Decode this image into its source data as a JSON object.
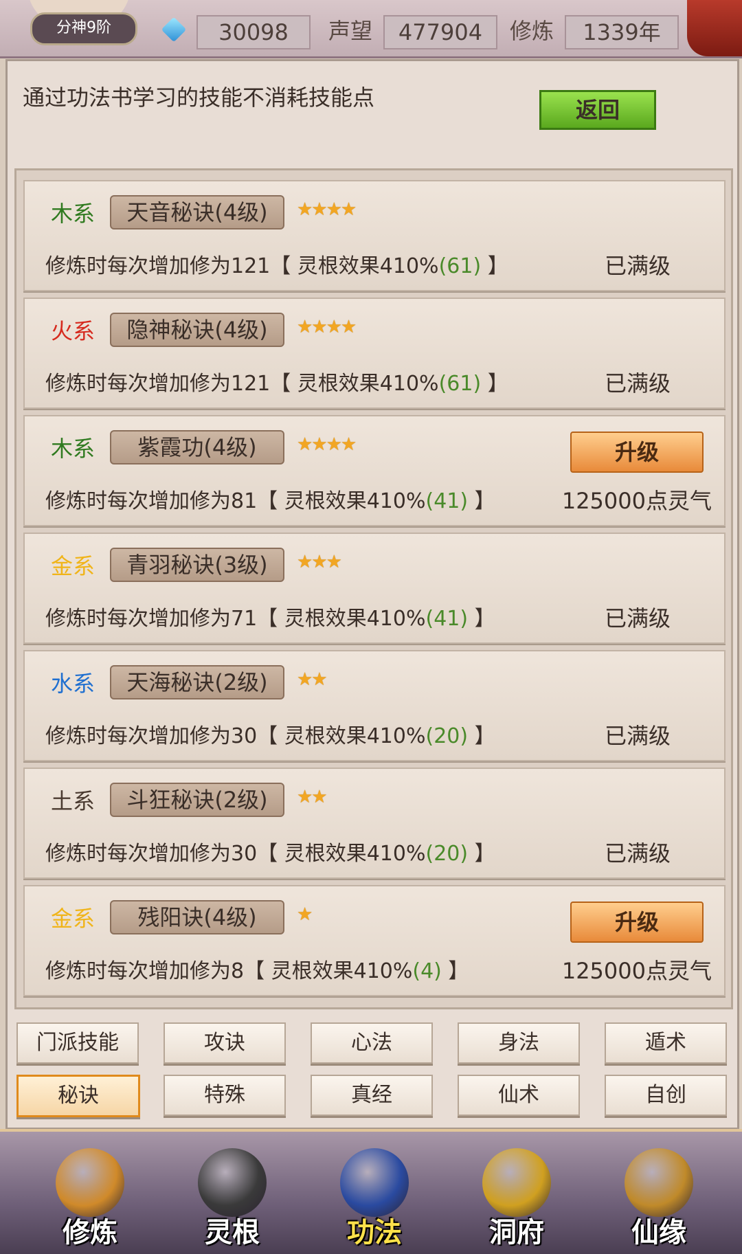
{
  "header": {
    "rank": "分神9阶",
    "gems": "30098",
    "reputation_label": "声望",
    "reputation": "477904",
    "cultivation_label": "修炼",
    "cultivation": "1339年"
  },
  "notice": "通过功法书学习的技能不消耗技能点",
  "back_label": "返回",
  "skills": [
    {
      "element": "木系",
      "element_color": "#2f7a1f",
      "name": "天音秘诀(4级)",
      "stars": "★★★★",
      "desc_pre": "修炼时每次增加修为121【 灵根效果410%",
      "desc_green": "(61)",
      "desc_post": " 】",
      "status": "已满级"
    },
    {
      "element": "火系",
      "element_color": "#d62a1e",
      "name": "隐神秘诀(4级)",
      "stars": "★★★★",
      "desc_pre": "修炼时每次增加修为121【 灵根效果410%",
      "desc_green": "(61)",
      "desc_post": " 】",
      "status": "已满级"
    },
    {
      "element": "木系",
      "element_color": "#2f7a1f",
      "name": "紫霞功(4级)",
      "stars": "★★★★",
      "desc_pre": "修炼时每次增加修为81【 灵根效果410%",
      "desc_green": "(41)",
      "desc_post": " 】",
      "upgrade": "升级",
      "cost": "125000点灵气"
    },
    {
      "element": "金系",
      "element_color": "#f0b419",
      "name": "青羽秘诀(3级)",
      "stars": "★★★",
      "desc_pre": "修炼时每次增加修为71【 灵根效果410%",
      "desc_green": "(41)",
      "desc_post": " 】",
      "status": "已满级"
    },
    {
      "element": "水系",
      "element_color": "#1f6fd0",
      "name": "天海秘诀(2级)",
      "stars": "★★",
      "desc_pre": "修炼时每次增加修为30【 灵根效果410%",
      "desc_green": "(20)",
      "desc_post": " 】",
      "status": "已满级"
    },
    {
      "element": "土系",
      "element_color": "#4a3a30",
      "name": "斗狂秘诀(2级)",
      "stars": "★★",
      "desc_pre": "修炼时每次增加修为30【 灵根效果410%",
      "desc_green": "(20)",
      "desc_post": " 】",
      "status": "已满级"
    },
    {
      "element": "金系",
      "element_color": "#f0b419",
      "name": "残阳诀(4级)",
      "stars": "★",
      "desc_pre": "修炼时每次增加修为8【 灵根效果410%",
      "desc_green": "(4)",
      "desc_post": " 】",
      "upgrade": "升级",
      "cost": "125000点灵气"
    }
  ],
  "tabs": [
    {
      "label": "门派技能"
    },
    {
      "label": "攻诀"
    },
    {
      "label": "心法"
    },
    {
      "label": "身法"
    },
    {
      "label": "遁术"
    },
    {
      "label": "秘诀",
      "active": true
    },
    {
      "label": "特殊"
    },
    {
      "label": "真经"
    },
    {
      "label": "仙术"
    },
    {
      "label": "自创"
    }
  ],
  "nav": [
    {
      "label": "修炼",
      "icon": "hooded-monk-icon",
      "color": "#d08a2a"
    },
    {
      "label": "灵根",
      "icon": "yin-yang-sword-icon",
      "color": "#3a3a3a"
    },
    {
      "label": "功法",
      "icon": "book-icon",
      "color": "#2a4aa0",
      "active": true
    },
    {
      "label": "洞府",
      "icon": "pagoda-icon",
      "color": "#d0a020"
    },
    {
      "label": "仙缘",
      "icon": "gourd-icon",
      "color": "#c08a2a"
    }
  ]
}
